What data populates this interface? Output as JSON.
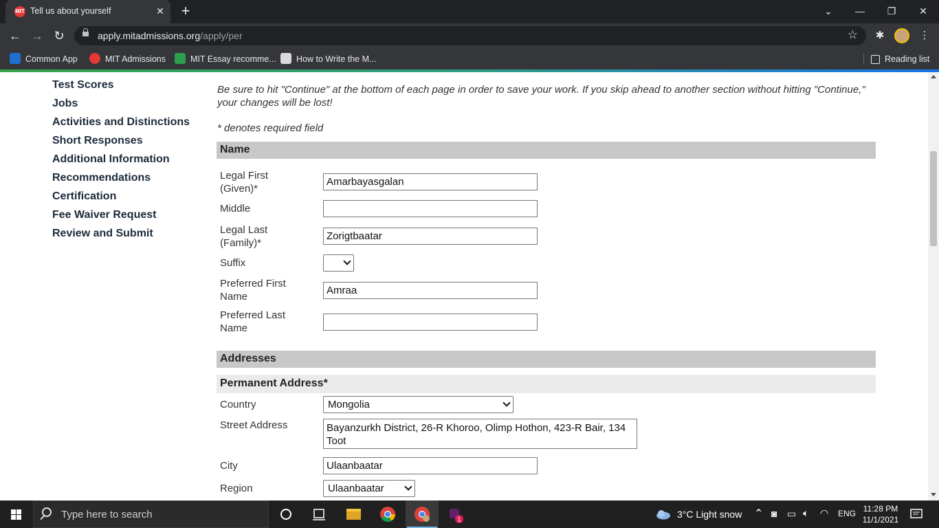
{
  "browser": {
    "tab_title": "Tell us about yourself",
    "url_domain": "apply.mitadmissions.org",
    "url_path": "/apply/per",
    "bookmarks": [
      "Common App",
      "MIT Admissions",
      "MIT Essay recomme...",
      "How to Write the M..."
    ],
    "reading_list": "Reading list"
  },
  "sidebar": {
    "items": [
      "Test Scores",
      "Jobs",
      "Activities and Distinctions",
      "Short Responses",
      "Additional Information",
      "Recommendations",
      "Certification",
      "Fee Waiver Request",
      "Review and Submit"
    ]
  },
  "main": {
    "notice": "Be sure to hit \"Continue\" at the bottom of each page in order to save your work. If you skip ahead to another section without hitting \"Continue,\" your changes will be lost!",
    "required_note": "* denotes required field",
    "name_section": {
      "title": "Name",
      "first_label_1": "Legal First",
      "first_label_2": "(Given)*",
      "first_value": "Amarbayasgalan",
      "middle_label": "Middle",
      "middle_value": "",
      "last_label_1": "Legal Last",
      "last_label_2": "(Family)*",
      "last_value": "Zorigtbaatar",
      "suffix_label": "Suffix",
      "suffix_value": "",
      "pref_first_label_1": "Preferred First",
      "pref_first_label_2": "Name",
      "pref_first_value": "Amraa",
      "pref_last_label_1": "Preferred Last",
      "pref_last_label_2": "Name",
      "pref_last_value": ""
    },
    "address_section": {
      "title": "Addresses",
      "permanent_title": "Permanent Address*",
      "country_label": "Country",
      "country_value": "Mongolia",
      "street_label": "Street Address",
      "street_value": "Bayanzurkh District, 26-R Khoroo, Olimp Hothon, 423-R Bair, 134 Toot",
      "city_label": "City",
      "city_value": "Ulaanbaatar",
      "region_label": "Region",
      "region_value": "Ulaanbaatar"
    }
  },
  "taskbar": {
    "search_placeholder": "Type here to search",
    "weather": "3°C  Light snow",
    "language": "ENG",
    "time": "11:28 PM",
    "date": "11/1/2021",
    "badge": "1"
  },
  "colors": {
    "chrome_dark": "#202124",
    "chrome_toolbar": "#35363a",
    "section_header": "#c8c8c8",
    "sidebar_text": "#1b2a3a"
  }
}
